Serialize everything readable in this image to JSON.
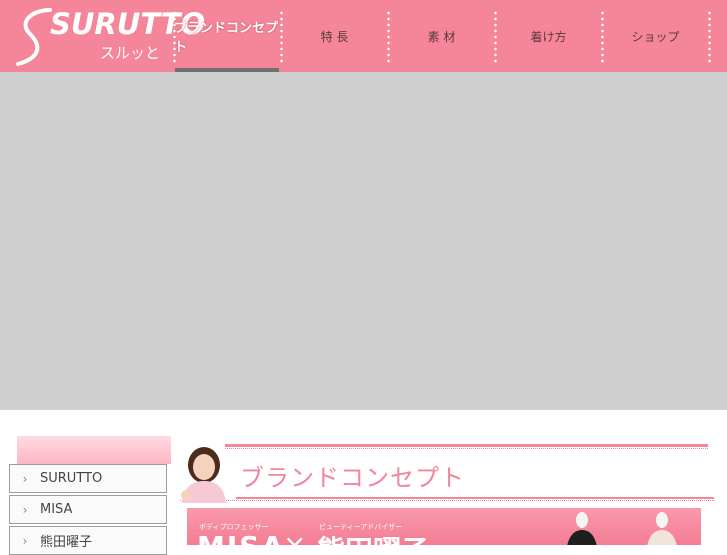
{
  "header": {
    "logo_text": "SURUTTO",
    "logo_sub": "スルッと",
    "nav": [
      {
        "label": "ブランドコンセプト",
        "active": true
      },
      {
        "label": "特 長",
        "active": false
      },
      {
        "label": "素 材",
        "active": false
      },
      {
        "label": "着け方",
        "active": false
      },
      {
        "label": "ショップ",
        "active": false
      }
    ]
  },
  "sidebar": {
    "items": [
      {
        "label": "SURUTTO"
      },
      {
        "label": "MISA"
      },
      {
        "label": "熊田曜子"
      }
    ]
  },
  "content": {
    "heading": "ブランドコンセプト",
    "banner": {
      "small_left": "ボディプロフェッサー",
      "small_right": "ビューティーアドバイザー",
      "name_left": "MISA",
      "cross": "×",
      "name_right": "熊田曜子"
    }
  },
  "colors": {
    "brand_pink": "#f58699",
    "nav_active_bar": "#707070",
    "hero_placeholder": "#cfcfcf"
  }
}
